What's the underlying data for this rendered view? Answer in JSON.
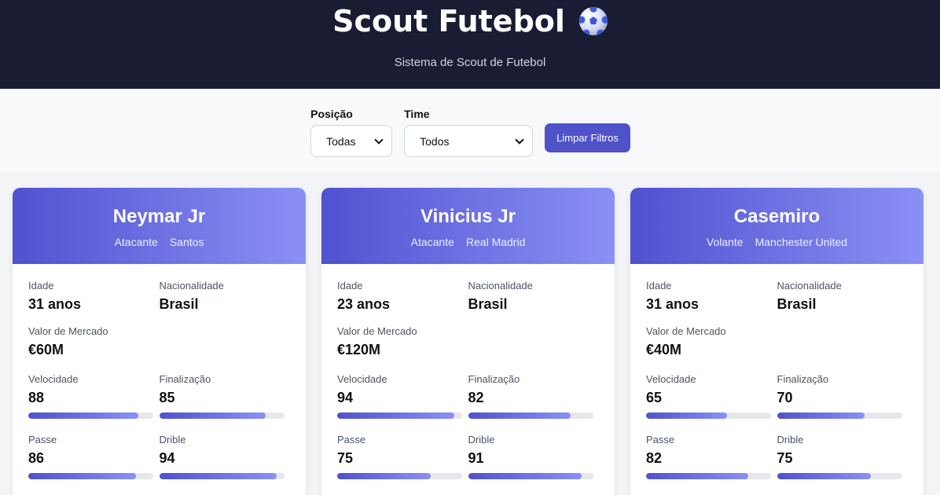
{
  "app": {
    "title": "Scout Futebol",
    "subtitle": "Sistema de Scout de Futebol",
    "icon": "soccer-ball-icon"
  },
  "filters": {
    "position_label": "Posição",
    "position_value": "Todas",
    "team_label": "Time",
    "team_value": "Todos",
    "clear_button": "Limpar Filtros"
  },
  "labels": {
    "age": "Idade",
    "nationality": "Nacionalidade",
    "market_value": "Valor de Mercado",
    "speed": "Velocidade",
    "finishing": "Finalização",
    "passing": "Passe",
    "dribbling": "Drible"
  },
  "colors": {
    "header_bg": "#191c33",
    "accent_start": "#4f52cf",
    "accent_end": "#8b90f5"
  },
  "players": [
    {
      "name": "Neymar Jr",
      "position": "Atacante",
      "team": "Santos",
      "age": "31 anos",
      "nationality": "Brasil",
      "market_value": "€60M",
      "stats": {
        "speed": 88,
        "finishing": 85,
        "passing": 86,
        "dribbling": 94
      }
    },
    {
      "name": "Vinicius Jr",
      "position": "Atacante",
      "team": "Real Madrid",
      "age": "23 anos",
      "nationality": "Brasil",
      "market_value": "€120M",
      "stats": {
        "speed": 94,
        "finishing": 82,
        "passing": 75,
        "dribbling": 91
      }
    },
    {
      "name": "Casemiro",
      "position": "Volante",
      "team": "Manchester United",
      "age": "31 anos",
      "nationality": "Brasil",
      "market_value": "€40M",
      "stats": {
        "speed": 65,
        "finishing": 70,
        "passing": 82,
        "dribbling": 75
      }
    }
  ]
}
